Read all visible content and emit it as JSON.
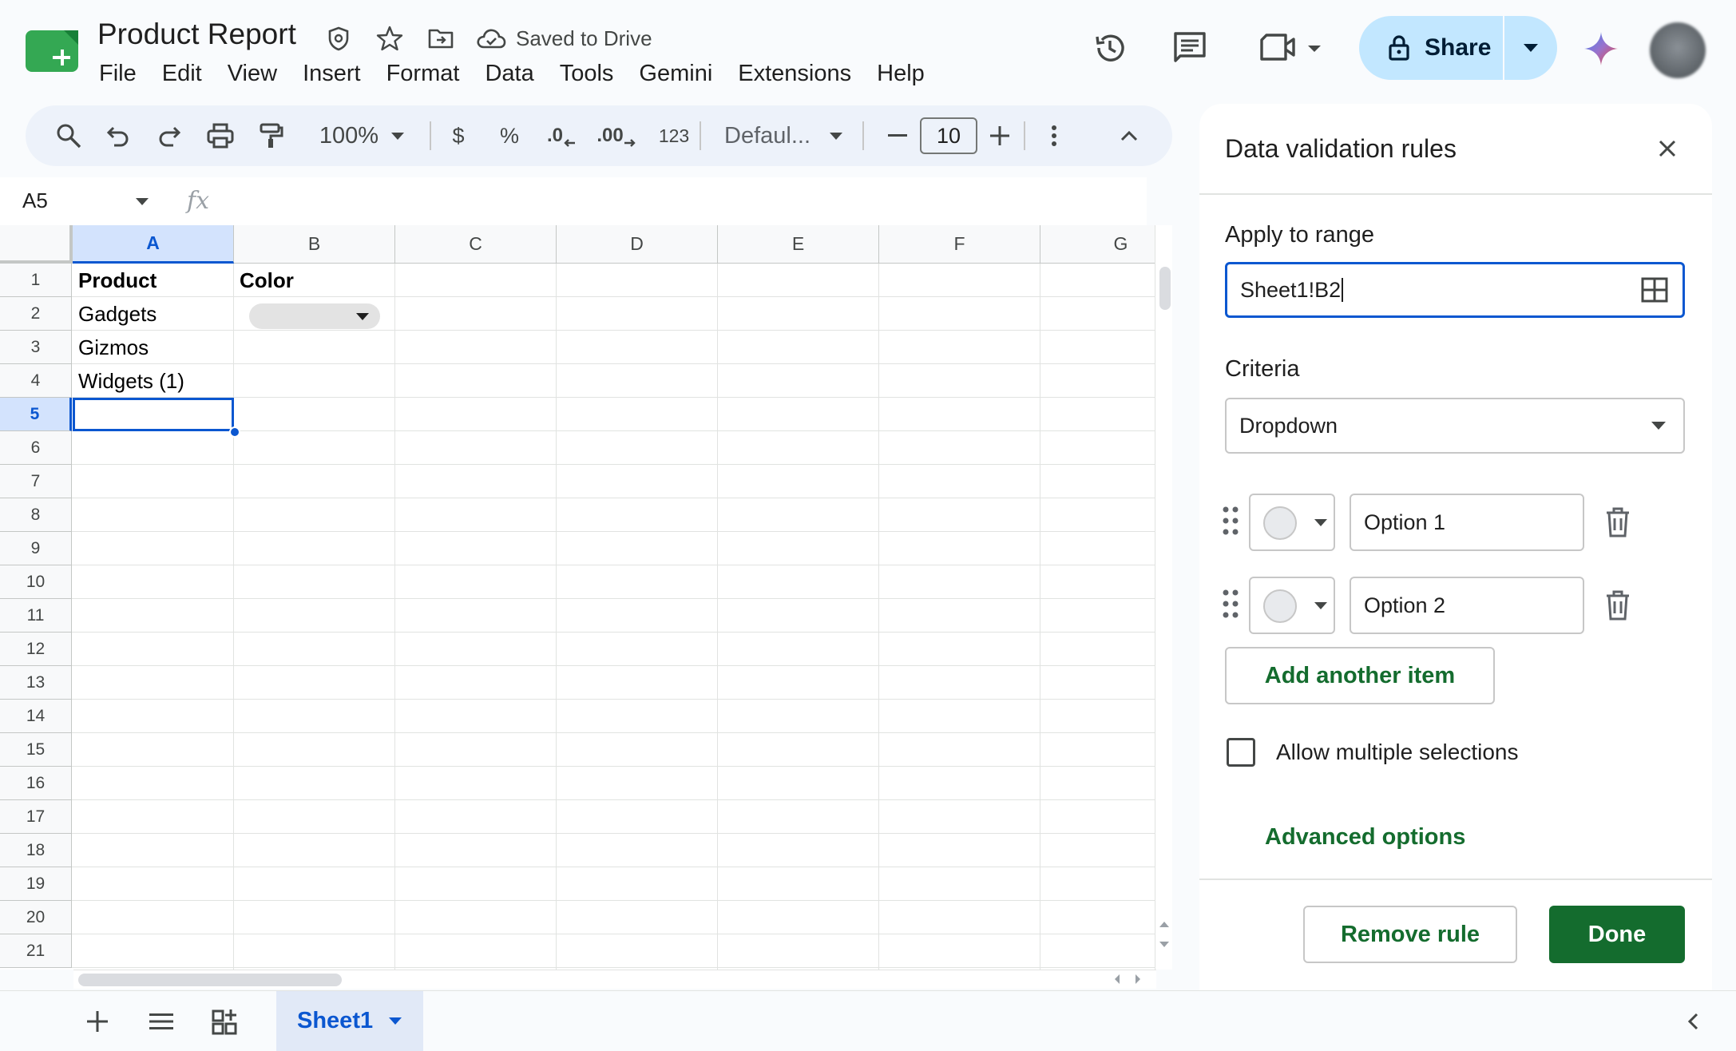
{
  "app": {
    "doc_title": "Product Report",
    "saved_status": "Saved to Drive",
    "menu": [
      "File",
      "Edit",
      "View",
      "Insert",
      "Format",
      "Data",
      "Tools",
      "Gemini",
      "Extensions",
      "Help"
    ],
    "share_label": "Share"
  },
  "toolbar": {
    "zoom": "100%",
    "currency": "$",
    "percent": "%",
    "decrease_decimal": ".0",
    "increase_decimal": ".00",
    "number_format": "123",
    "font": "Defaul...",
    "font_size": "10"
  },
  "namebox": {
    "cell_ref": "A5",
    "fx": "fx"
  },
  "grid": {
    "columns": [
      "A",
      "B",
      "C",
      "D",
      "E",
      "F",
      "G"
    ],
    "selected_column": "A",
    "rows": [
      "1",
      "2",
      "3",
      "4",
      "5",
      "6",
      "7",
      "8",
      "9",
      "10",
      "11",
      "12",
      "13",
      "14",
      "15",
      "16",
      "17",
      "18",
      "19",
      "20",
      "21"
    ],
    "selected_row": "5",
    "cells": {
      "A1": "Product",
      "B1": "Color",
      "A2": "Gadgets",
      "A3": "Gizmos",
      "A4": "Widgets (1)"
    }
  },
  "sheets": {
    "active": "Sheet1"
  },
  "panel": {
    "title": "Data validation rules",
    "apply_to_range_label": "Apply to range",
    "range_value": "Sheet1!B2",
    "criteria_label": "Criteria",
    "criteria_value": "Dropdown",
    "options": [
      {
        "value": "Option 1",
        "color": "#e8eaed"
      },
      {
        "value": "Option 2",
        "color": "#e8eaed"
      }
    ],
    "add_item_label": "Add another item",
    "allow_multiple_label": "Allow multiple selections",
    "allow_multiple_checked": false,
    "advanced_label": "Advanced options",
    "remove_rule_label": "Remove rule",
    "done_label": "Done"
  },
  "colors": {
    "accent_blue": "#0b57d0",
    "share_bg": "#c2e7ff",
    "done_green": "#146c2e",
    "selection_bg": "#d3e3fd"
  }
}
